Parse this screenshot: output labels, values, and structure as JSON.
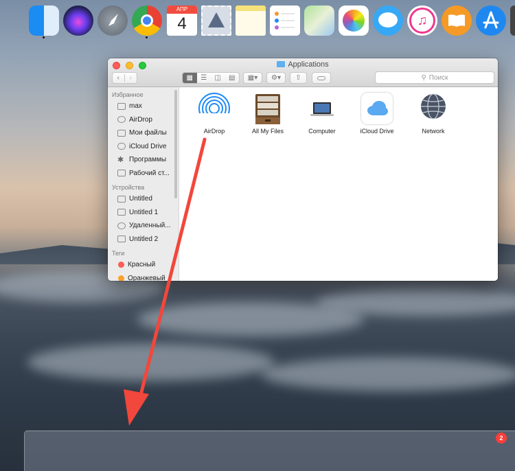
{
  "window": {
    "title": "Applications",
    "search_placeholder": "Поиск"
  },
  "sidebar": {
    "favorites_header": "Избранное",
    "favorites": [
      {
        "label": "max",
        "icon": "home-folder-icon"
      },
      {
        "label": "AirDrop",
        "icon": "airdrop-icon"
      },
      {
        "label": "Мои файлы",
        "icon": "all-files-icon"
      },
      {
        "label": "iCloud Drive",
        "icon": "cloud-icon"
      },
      {
        "label": "Программы",
        "icon": "applications-icon"
      },
      {
        "label": "Рабочий ст...",
        "icon": "desktop-icon"
      }
    ],
    "devices_header": "Устройства",
    "devices": [
      {
        "label": "Untitled",
        "icon": "disk-icon"
      },
      {
        "label": "Untitled 1",
        "icon": "disk-icon"
      },
      {
        "label": "Удаленный...",
        "icon": "remote-disc-icon"
      },
      {
        "label": "Untitled 2",
        "icon": "disk-icon"
      }
    ],
    "tags_header": "Теги",
    "tags": [
      {
        "label": "Красный",
        "color": "#fc5d56"
      },
      {
        "label": "Оранжевый",
        "color": "#fda12a"
      }
    ]
  },
  "files": [
    {
      "label": "AirDrop",
      "icon": "airdrop-icon"
    },
    {
      "label": "All My Files",
      "icon": "file-cabinet-icon"
    },
    {
      "label": "Computer",
      "icon": "laptop-icon"
    },
    {
      "label": "iCloud Drive",
      "icon": "icloud-drive-icon"
    },
    {
      "label": "Network",
      "icon": "network-globe-icon"
    }
  ],
  "dock": {
    "items": [
      {
        "name": "finder",
        "icon": "finder-icon",
        "running": true
      },
      {
        "name": "siri",
        "icon": "siri-icon",
        "running": false
      },
      {
        "name": "launchpad",
        "icon": "rocket-icon",
        "running": false
      },
      {
        "name": "chrome",
        "icon": "chrome-icon",
        "running": true
      },
      {
        "name": "calendar",
        "icon": "calendar-icon",
        "running": false
      },
      {
        "name": "mail",
        "icon": "stamp-icon",
        "running": false
      },
      {
        "name": "notes",
        "icon": "notes-icon",
        "running": false
      },
      {
        "name": "reminders",
        "icon": "reminders-icon",
        "running": false
      },
      {
        "name": "maps",
        "icon": "map-icon",
        "running": false
      },
      {
        "name": "photos",
        "icon": "photos-icon",
        "running": false
      },
      {
        "name": "messages",
        "icon": "messages-icon",
        "running": false
      },
      {
        "name": "itunes",
        "icon": "music-icon",
        "running": false
      },
      {
        "name": "ibooks",
        "icon": "book-icon",
        "running": false
      },
      {
        "name": "app-store",
        "icon": "app-store-icon",
        "running": false
      }
    ],
    "calendar_month": "АПР",
    "calendar_day": "4",
    "app_store_badge": "2"
  },
  "colors": {
    "accent": "#1d8bf5",
    "arrow": "#f2473c"
  }
}
